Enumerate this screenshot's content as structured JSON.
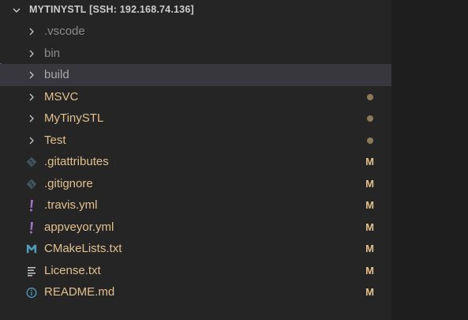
{
  "explorer": {
    "title": "MYTINYSTL [SSH: 192.168.74.136]"
  },
  "colors": {
    "background": "#252526",
    "selected_row": "#37373d",
    "modified": "#e2c08d",
    "dot": "#8c7a58",
    "git_icon": "#41535b",
    "yaml_icon": "#a074c4",
    "cmake_icon": "#519aba",
    "info_icon": "#519aba",
    "text_icon": "#c5c5c5",
    "accent": "#3794ff"
  },
  "tree": {
    "items": [
      {
        "label": ".vscode",
        "type": "folder",
        "icon": "chevron-right-icon",
        "decoration": ""
      },
      {
        "label": "bin",
        "type": "folder",
        "icon": "chevron-right-icon",
        "decoration": ""
      },
      {
        "label": "build",
        "type": "folder",
        "icon": "chevron-right-icon",
        "decoration": ""
      },
      {
        "label": "MSVC",
        "type": "folder",
        "icon": "chevron-right-icon",
        "decoration": "•"
      },
      {
        "label": "MyTinySTL",
        "type": "folder",
        "icon": "chevron-right-icon",
        "decoration": "•"
      },
      {
        "label": "Test",
        "type": "folder",
        "icon": "chevron-right-icon",
        "decoration": "•"
      },
      {
        "label": ".gitattributes",
        "type": "file",
        "icon": "git-icon",
        "decoration": "M"
      },
      {
        "label": ".gitignore",
        "type": "file",
        "icon": "git-icon",
        "decoration": "M"
      },
      {
        "label": ".travis.yml",
        "type": "file",
        "icon": "yaml-icon",
        "decoration": "M"
      },
      {
        "label": "appveyor.yml",
        "type": "file",
        "icon": "yaml-icon",
        "decoration": "M"
      },
      {
        "label": "CMakeLists.txt",
        "type": "file",
        "icon": "cmake-icon",
        "decoration": "M"
      },
      {
        "label": "License.txt",
        "type": "file",
        "icon": "text-file-icon",
        "decoration": "M"
      },
      {
        "label": "README.md",
        "type": "file",
        "icon": "info-icon",
        "decoration": "M"
      }
    ]
  }
}
